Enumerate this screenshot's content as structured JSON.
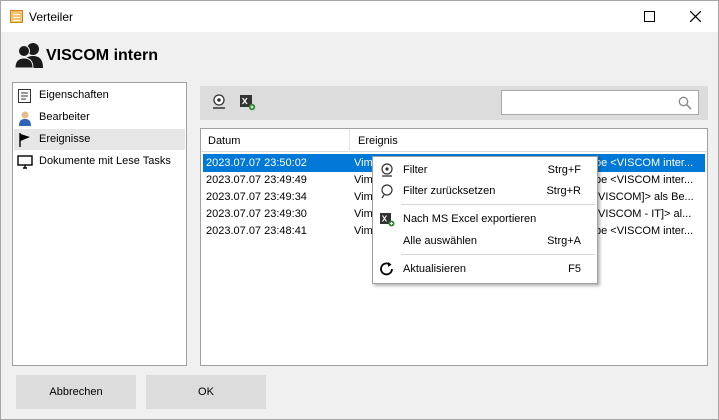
{
  "window": {
    "title": "Verteiler"
  },
  "header": {
    "title": "VISCOM intern"
  },
  "sidebar": {
    "items": [
      {
        "label": "Eigenschaften"
      },
      {
        "label": "Bearbeiter"
      },
      {
        "label": "Ereignisse"
      },
      {
        "label": "Dokumente mit Lese Tasks"
      }
    ],
    "selected_index": 2
  },
  "toolbar": {
    "search": {
      "value": "",
      "placeholder": ""
    }
  },
  "grid": {
    "columns": [
      "Datum",
      "Ereignis"
    ],
    "rows": [
      {
        "date": "2023.07.07 23:50:02",
        "left": "Vim",
        "right": "pe <VISCOM inter..."
      },
      {
        "date": "2023.07.07 23:49:49",
        "left": "Vim",
        "right": "pe <VISCOM inter..."
      },
      {
        "date": "2023.07.07 23:49:34",
        "left": "Vim",
        "right": "[VISCOM]> als Be..."
      },
      {
        "date": "2023.07.07 23:49:30",
        "left": "Vim",
        "right": "[VISCOM - IT]> al..."
      },
      {
        "date": "2023.07.07 23:48:41",
        "left": "Vim",
        "right": "pe <VISCOM inter..."
      }
    ],
    "selected_index": 0
  },
  "context_menu": {
    "items": [
      {
        "label": "Filter",
        "shortcut": "Strg+F",
        "icon": "filter-icon"
      },
      {
        "label": "Filter zurücksetzen",
        "shortcut": "Strg+R",
        "icon": "filter-reset-icon"
      },
      {
        "label": "Nach MS Excel exportieren",
        "shortcut": "",
        "icon": "excel-export-icon"
      },
      {
        "label": "Alle auswählen",
        "shortcut": "Strg+A",
        "icon": ""
      },
      {
        "label": "Aktualisieren",
        "shortcut": "F5",
        "icon": "refresh-icon"
      }
    ]
  },
  "buttons": {
    "cancel": "Abbrechen",
    "ok": "OK"
  },
  "colors": {
    "selection": "#0078d7",
    "accent_yellow": "#f5c26b"
  }
}
